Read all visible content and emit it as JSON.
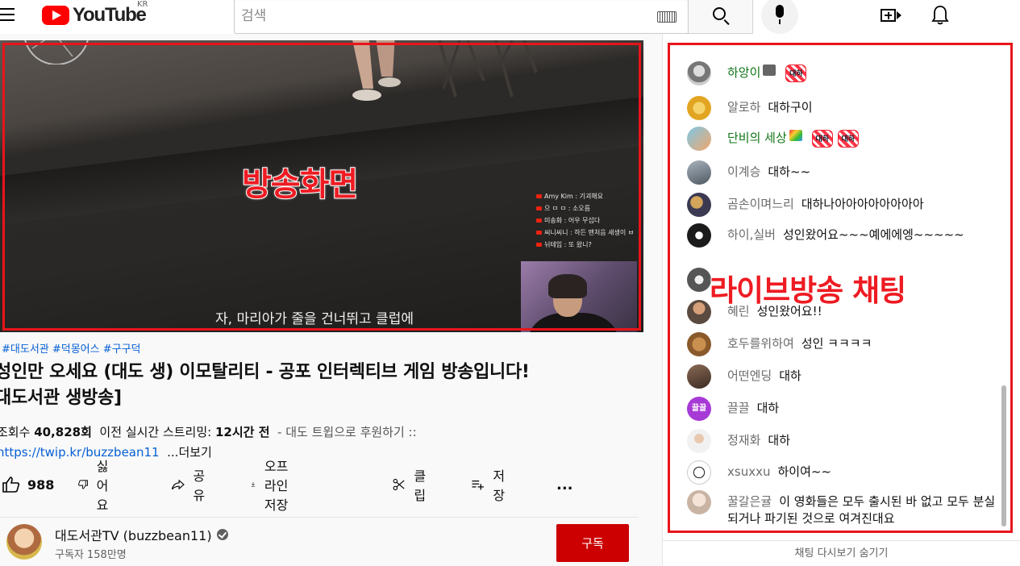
{
  "header": {
    "logo_text": "YouTube",
    "region": "KR",
    "search_placeholder": "검색"
  },
  "player": {
    "overlay_label": "방송화면",
    "subtitle": "자, 마리아가 줄을 건너뛰고 클럽에",
    "mini_chat": [
      "Amy Kim : 기괴해요",
      "으 ㅁ ㅁ : 소오름",
      "미송화 : 어우 무섭다",
      "씨니씨니 : 하든 맨처음 새생이 ㅂ",
      "뉘테임 : 또 왔니?"
    ]
  },
  "video": {
    "tags": "#대도서관 #덕몽어스 #구구덕",
    "title_line1": "성인만 오세요 (대도 생) 이모탈리티 - 공포 인터렉티브 게임 방송입니다!",
    "title_line2": "대도서관 생방송]",
    "views_label": "조회수",
    "views_value": "40,828회",
    "stream_label": "이전 실시간 스트리밍:",
    "stream_value": "12시간 전",
    "desc_snippet": "- 대도 트윕으로 후원하기 ::",
    "link": "https://twip.kr/buzzbean11",
    "more": "...더보기"
  },
  "actions": {
    "like_count": "988",
    "dislike": "싫어요",
    "share": "공유",
    "offline": "오프라인 저장",
    "clip": "클립",
    "save": "저장",
    "more": "..."
  },
  "channel": {
    "name": "대도서관TV (buzzbean11)",
    "subscribers": "구독자 158만명",
    "subscribe": "구독"
  },
  "chat": {
    "overlay_label": "라이브방송 채팅",
    "footer": "채팅 다시보기 숨기기",
    "messages": [
      {
        "name": "하앙이",
        "text": ""
      },
      {
        "name": "알로하",
        "text": "대하구이"
      },
      {
        "name": "단비의 세상",
        "text": ""
      },
      {
        "name": "이계승",
        "text": "대하~~"
      },
      {
        "name": "곰손이며느리",
        "text": "대하나아아아아아아아아"
      },
      {
        "name": "하이,실버",
        "text": "성인왔어요~~~예에에엥~~~~~"
      },
      {
        "name": "혜린",
        "text": "성인왔어요!!"
      },
      {
        "name": "호두를위하여",
        "text": "성인 ㅋㅋㅋㅋ"
      },
      {
        "name": "어떤엔딩",
        "text": "대하"
      },
      {
        "name": "끌끌",
        "text": "대하"
      },
      {
        "name": "정재화",
        "text": "대하"
      },
      {
        "name": "xsuxxu",
        "text": "하이여~~"
      },
      {
        "name": "꿀갈은귤",
        "text": "이 영화들은 모두 출시된 바 없고 모두 분실되거나 파기된 것으로 여겨진대요"
      }
    ],
    "sticker_text": "대하",
    "badge_avatar_text": "끌끌"
  }
}
